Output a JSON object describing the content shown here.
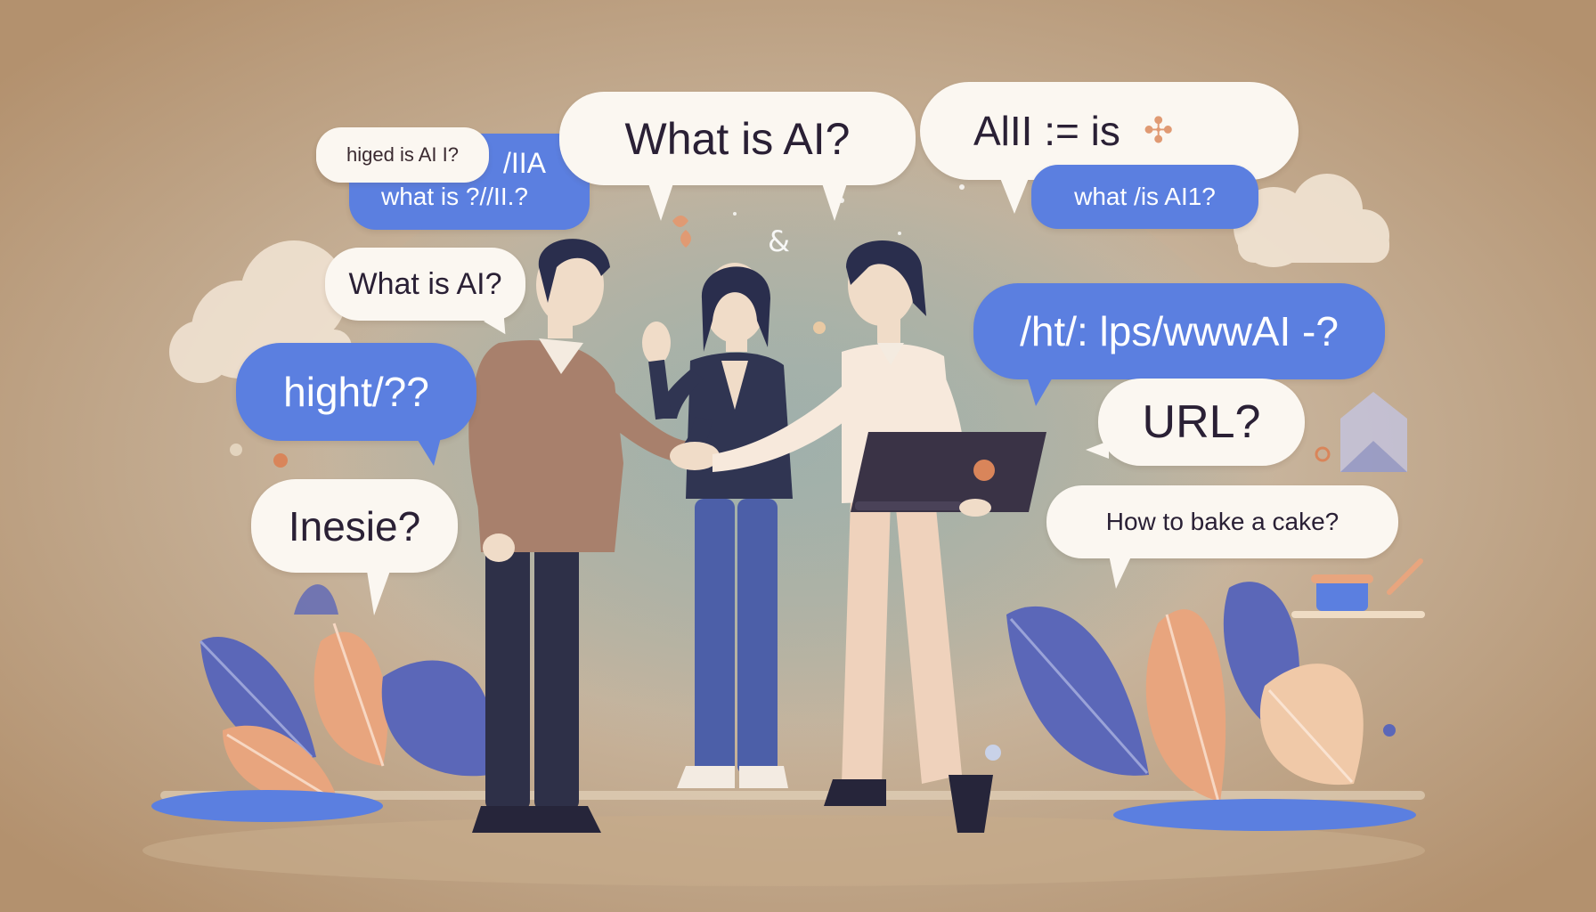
{
  "bubbles": {
    "b1": "higed is AI I?",
    "b2": "/IIA",
    "b3": "what is ?//II.?",
    "b4": "What is AI?",
    "b5": "AlII :=  is",
    "b6": "what /is AI1?",
    "b7": "What is AI?",
    "b8": "hight/??",
    "b9": "Inesie?",
    "b10": "/ht/: lps/wwwAI -?",
    "b11": "URL?",
    "b12": "How to bake a cake?"
  },
  "colors": {
    "background": "#b99a7a",
    "bubble_blue": "#5b7fe0",
    "bubble_light": "#fbf7f1",
    "leaf_blue": "#5b67b8",
    "leaf_peach": "#e8a57e"
  }
}
